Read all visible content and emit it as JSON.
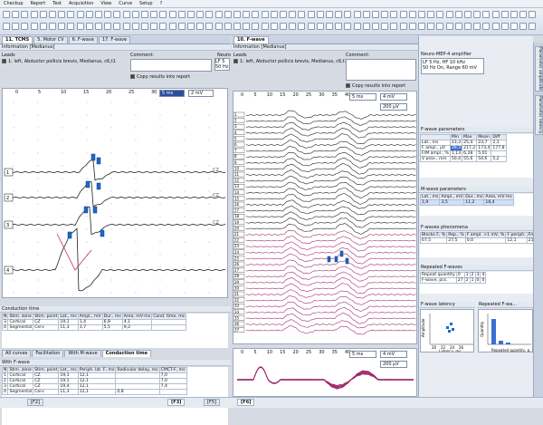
{
  "menu": [
    "Checkup",
    "Report",
    "Test",
    "Acquisition",
    "View",
    "Curve",
    "Setup",
    "?"
  ],
  "left_tabs": [
    "11. TCMS",
    "5. Motor CV",
    "6. F-wave",
    "17. F-wave"
  ],
  "info": {
    "title": "Information [Medianus]",
    "leads_label": "Leads",
    "comment_label": "Comment:",
    "lead_text": "1: left, Abductor pollicis brevis, Medianus, c6,t1",
    "copy_label": "Copy results into report"
  },
  "neuro_short": [
    "Neuro",
    "LF 5",
    "50 Hz"
  ],
  "left_plot": {
    "ticks": [
      "0",
      "5",
      "10",
      "15",
      "20",
      "25",
      "30"
    ],
    "time_div": "5 ms",
    "gain": "2 mV",
    "channels": [
      "1",
      "2",
      "3",
      "4"
    ],
    "cz": [
      "CZ",
      "CZ",
      "CZ"
    ]
  },
  "conduction": {
    "title": "Conduction time",
    "headers": [
      "N",
      "Stim. zone",
      "Stim. point",
      "Lat., ms",
      "Ampl., mV",
      "Dur., ms",
      "Area, mV·ms",
      "Cond. time, ms"
    ],
    "rows": [
      [
        "3",
        "Cortical",
        "CZ",
        "19,1",
        "1,4",
        "6,8",
        "4,1",
        ""
      ],
      [
        "4",
        "Segmental",
        "Cerv",
        "11,3",
        "3,7",
        "5,5",
        "9,2",
        ""
      ]
    ]
  },
  "sub_tabs": [
    "All curves",
    "Facilitation",
    "With M-wave",
    "Conduction time"
  ],
  "fwave_table": {
    "title": "With F-wave",
    "headers": [
      "N",
      "Stim. zone",
      "Stim. point",
      "Lat., ms",
      "Periph. lat. F, ms",
      "Radicular delay, ms",
      "CMCT-F, ms"
    ],
    "rows": [
      [
        "1",
        "Cortical",
        "CZ",
        "19,1",
        "12,1",
        "",
        "7,0"
      ],
      [
        "2",
        "Cortical",
        "CZ",
        "19,1",
        "12,1",
        "",
        "7,0"
      ],
      [
        "3",
        "Cortical",
        "CZ",
        "19,4",
        "12,1",
        "",
        "7,4"
      ],
      [
        "4",
        "Segmental",
        "Cerv",
        "11,3",
        "12,1",
        "0,8",
        ""
      ]
    ]
  },
  "right_tab": "10. F-wave",
  "amp": {
    "title": "Neuro-MEP-4 amplifier",
    "lines": [
      "LF  5 Hz,  HF  10 kHz",
      "50 Hz  On,  Range 60 mV"
    ]
  },
  "mid_plot": {
    "ticks": [
      "0",
      "5",
      "10",
      "15",
      "20",
      "25",
      "30",
      "35",
      "40"
    ],
    "time_div": "5 ms",
    "gain1": "4 mV",
    "gain2": "200 µV",
    "traces": [
      "1",
      "2",
      "3",
      "4",
      "5",
      "6",
      "7",
      "8",
      "9",
      "10",
      "11",
      "12",
      "13",
      "14",
      "15",
      "16",
      "17",
      "18",
      "19",
      "20",
      "21",
      "22",
      "23",
      "24",
      "25",
      "26",
      "27",
      "28",
      "29",
      "30",
      "31",
      "32",
      "33",
      "34",
      "35",
      "36",
      "37"
    ],
    "marker_f": "F",
    "marker_tag": "36"
  },
  "low_plot": {
    "ticks": [
      "0",
      "5",
      "10",
      "15",
      "20",
      "25",
      "30",
      "35",
      "40"
    ],
    "time_div": "5 ms",
    "gain1": "4 mV",
    "gain2": "200 µV"
  },
  "fparams": {
    "title": "F-wave parameters",
    "headers": [
      "",
      "Min",
      "Max",
      "Mean",
      "Diff"
    ],
    "rows": [
      [
        "Lat., ms",
        "23,3",
        "25,4",
        "23,7",
        "2,1"
      ],
      [
        "F ampl., µV",
        "39,3",
        "217,2",
        "173,4",
        "177,8"
      ],
      [
        "F/M ampl., %",
        "1,13",
        "6,28",
        "5,01",
        ""
      ],
      [
        "V prox., m/s",
        "50,4",
        "55,6",
        "54,6",
        "5,2"
      ]
    ]
  },
  "mwave": {
    "title": "M-wave parameters",
    "headers": [
      "Lat., ms",
      "Ampl., mV",
      "Dur., ms",
      "Area, mV·ms"
    ],
    "row": [
      "1,9",
      "3,5",
      "11,2",
      "18,4"
    ]
  },
  "phen": {
    "title": "F-waves phenomena",
    "headers": [
      "Blocks F, %",
      "Rep., %",
      "F ampl. >1 mV, %",
      "F periph.",
      "Fmin-M lat., ms"
    ],
    "row": [
      "67,5",
      "27,5",
      "0,0",
      "12,1",
      "21,5"
    ]
  },
  "rep": {
    "title": "Repeated F-waves",
    "header": [
      "Repeat quantity",
      "0",
      "1",
      "2",
      "3",
      "4"
    ],
    "row": [
      "F-wave, pcs.",
      "27",
      "2",
      "1",
      "0",
      "0"
    ]
  },
  "latency_chart": {
    "title": "F-wave latency",
    "xlabel": "Latency, ms",
    "ylabel": "Amplitude",
    "ticks": [
      "20",
      "22",
      "24",
      "26"
    ]
  },
  "repeat_chart": {
    "title": "Repeated F-wa...",
    "xlabel": "Repeated quantity, p...",
    "ylabel": "Quantity"
  },
  "side_tabs": [
    "Parameter amplitude",
    "Parameter latency"
  ],
  "bottom_tabs": [
    "[F2]",
    "[F3]",
    "[F5]",
    "[F6]"
  ]
}
